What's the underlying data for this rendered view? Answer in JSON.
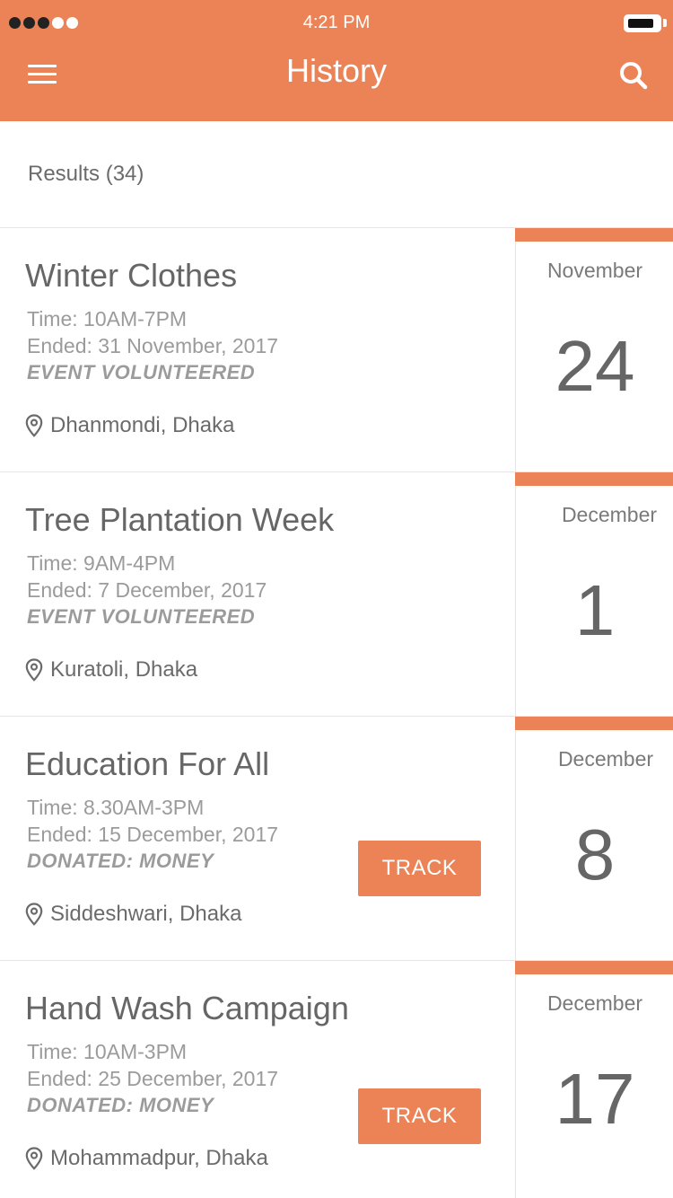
{
  "status_bar": {
    "time": "4:21 PM",
    "signal_filled": 3,
    "signal_total": 5
  },
  "header": {
    "title": "History",
    "menu_icon": "hamburger-menu-icon",
    "search_icon": "search-icon"
  },
  "results_label": "Results (34)",
  "colors": {
    "accent": "#ec8357",
    "text_dark": "#666666",
    "text_light": "#9b9b9b",
    "divider": "#e4e4e4"
  },
  "events": [
    {
      "title": "Winter Clothes",
      "time": "Time: 10AM-7PM",
      "ended": "Ended: 31 November, 2017",
      "status": "EVENT VOLUNTEERED",
      "location": "Dhanmondi, Dhaka",
      "month": "November",
      "day": "24",
      "track_label": null
    },
    {
      "title": "Tree Plantation Week",
      "time": "Time: 9AM-4PM",
      "ended": "Ended: 7 December, 2017",
      "status": "EVENT VOLUNTEERED",
      "location": "Kuratoli, Dhaka",
      "month": "December",
      "day": "1",
      "track_label": null
    },
    {
      "title": "Education For All",
      "time": "Time: 8.30AM-3PM",
      "ended": "Ended: 15 December, 2017",
      "status": "DONATED: MONEY",
      "location": "Siddeshwari, Dhaka",
      "month": "December",
      "day": "8",
      "track_label": "TRACK"
    },
    {
      "title": "Hand Wash Campaign",
      "time": "Time: 10AM-3PM",
      "ended": "Ended: 25 December, 2017",
      "status": "DONATED: MONEY",
      "location": "Mohammadpur, Dhaka",
      "month": "December",
      "day": "17",
      "track_label": "TRACK"
    }
  ]
}
